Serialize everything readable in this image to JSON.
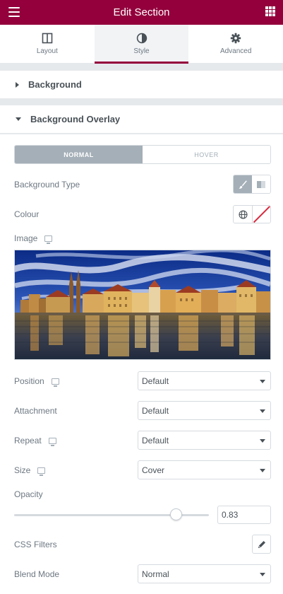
{
  "header": {
    "title": "Edit Section",
    "menu_icon": "hamburger-icon",
    "apps_icon": "grid-icon",
    "bg_color": "#93003c"
  },
  "tabs": [
    {
      "label": "Layout",
      "icon": "layout-icon"
    },
    {
      "label": "Style",
      "icon": "contrast-icon",
      "active": true
    },
    {
      "label": "Advanced",
      "icon": "gear-icon"
    }
  ],
  "sections": {
    "background": {
      "title": "Background",
      "expanded": false
    },
    "overlay": {
      "title": "Background Overlay",
      "expanded": true
    }
  },
  "overlay": {
    "state_tabs": {
      "normal": "NORMAL",
      "hover": "HOVER",
      "active": "normal"
    },
    "background_type": {
      "label": "Background Type",
      "options": [
        "brush-icon",
        "gradient-icon"
      ],
      "selected": "classic"
    },
    "colour": {
      "label": "Colour",
      "value": ""
    },
    "image": {
      "label": "Image"
    },
    "position": {
      "label": "Position",
      "value": "Default"
    },
    "attachment": {
      "label": "Attachment",
      "value": "Default"
    },
    "repeat": {
      "label": "Repeat",
      "value": "Default"
    },
    "size": {
      "label": "Size",
      "value": "Cover"
    },
    "opacity": {
      "label": "Opacity",
      "value": "0.83",
      "fraction": 0.83
    },
    "css_filters": {
      "label": "CSS Filters"
    },
    "blend_mode": {
      "label": "Blend Mode",
      "value": "Normal"
    }
  }
}
